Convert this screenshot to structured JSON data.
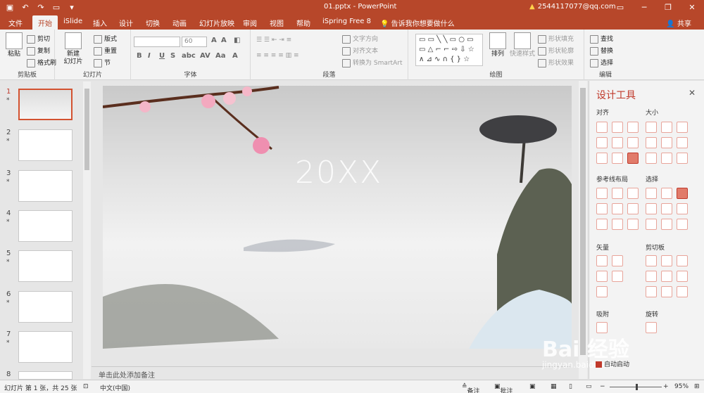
{
  "window": {
    "title": "01.pptx - PowerPoint",
    "account": "2544117077@qq.com",
    "warning_icon": "warning-icon"
  },
  "menu": {
    "tabs": [
      "文件",
      "开始",
      "iSlide",
      "插入",
      "设计",
      "切换",
      "动画",
      "幻灯片放映",
      "审阅",
      "视图",
      "帮助",
      "iSpring Free 8"
    ],
    "active": "开始",
    "tell": "告诉我你想要做什么",
    "share": "共享"
  },
  "ribbon": {
    "clipboard": {
      "label": "剪贴板",
      "paste": "粘贴",
      "cut": "剪切",
      "copy": "复制",
      "format": "格式刷"
    },
    "slides": {
      "label": "幻灯片",
      "new": "新建\n幻灯片",
      "layout": "版式",
      "reset": "重置",
      "section": "节"
    },
    "font": {
      "label": "字体",
      "size": "60"
    },
    "paragraph": {
      "label": "段落",
      "direction": "文字方向",
      "align": "对齐文本",
      "smartart": "转换为 SmartArt"
    },
    "drawing": {
      "label": "绘图",
      "arrange": "排列",
      "quick": "快速样式",
      "fill": "形状填充",
      "outline": "形状轮廓",
      "effect": "形状效果"
    },
    "edit": {
      "label": "编辑",
      "find": "查找",
      "replace": "替换",
      "select": "选择"
    }
  },
  "slides": {
    "numbers": [
      "1",
      "2",
      "3",
      "4",
      "5",
      "6",
      "7",
      "8"
    ],
    "count_label": "幻灯片 第 1 张，共 25 张"
  },
  "slide": {
    "title": "20XX"
  },
  "notes": "单击此处添加备注",
  "design_pane": {
    "title": "设计工具",
    "sections": {
      "align": "对齐",
      "size": "大小",
      "guide": "参考线布局",
      "select": "选择",
      "vector": "矢量",
      "clip": "剪切板",
      "snap": "吸附",
      "rotate": "旋转"
    },
    "auto": "自动启动"
  },
  "status": {
    "lang": "中文(中国)",
    "notes": "备注",
    "comments": "批注",
    "zoom": "95%"
  },
  "watermark": {
    "main": "Bai  经验",
    "sub": "jingyan.baidu.com"
  }
}
